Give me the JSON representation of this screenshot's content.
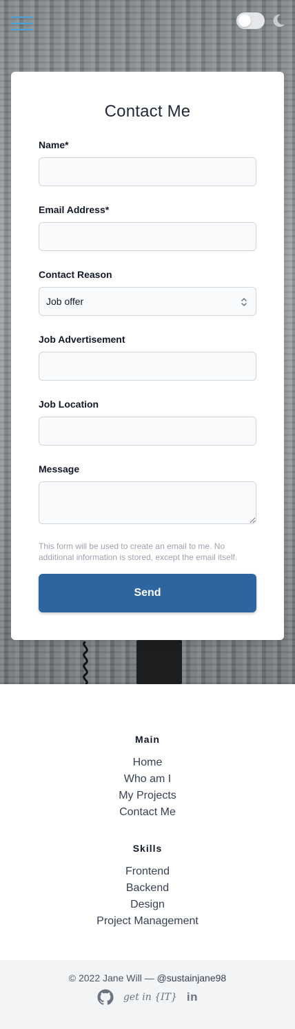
{
  "header": {
    "menu_icon": "hamburger-icon",
    "theme_toggle": "toggle-switch",
    "theme_icon": "moon-icon"
  },
  "form": {
    "title": "Contact Me",
    "fields": [
      {
        "label": "Name*",
        "value": "",
        "placeholder": ""
      },
      {
        "label": "Email Address*",
        "value": "",
        "placeholder": ""
      },
      {
        "label": "Contact Reason",
        "value": "Job offer"
      },
      {
        "label": "Job Advertisement",
        "value": "",
        "placeholder": ""
      },
      {
        "label": "Job Location",
        "value": "",
        "placeholder": ""
      },
      {
        "label": "Message",
        "value": "",
        "placeholder": ""
      }
    ],
    "note": "This form will be used to create an email to me. No additional information is stored, except the email itself.",
    "send_label": "Send",
    "send_color": "#2e64a0"
  },
  "footer": {
    "main_heading": "Main",
    "main_links": [
      "Home",
      "Who am I",
      "My Projects",
      "Contact Me"
    ],
    "skills_heading": "Skills",
    "skills_links": [
      "Frontend",
      "Backend",
      "Design",
      "Project Management"
    ],
    "copyright": "© 2022 Jane Will — ",
    "handle": "@sustainjane98",
    "socials": {
      "github_icon": "github-icon",
      "getin_label": "get in {IT}",
      "linkedin_label": "in"
    }
  }
}
